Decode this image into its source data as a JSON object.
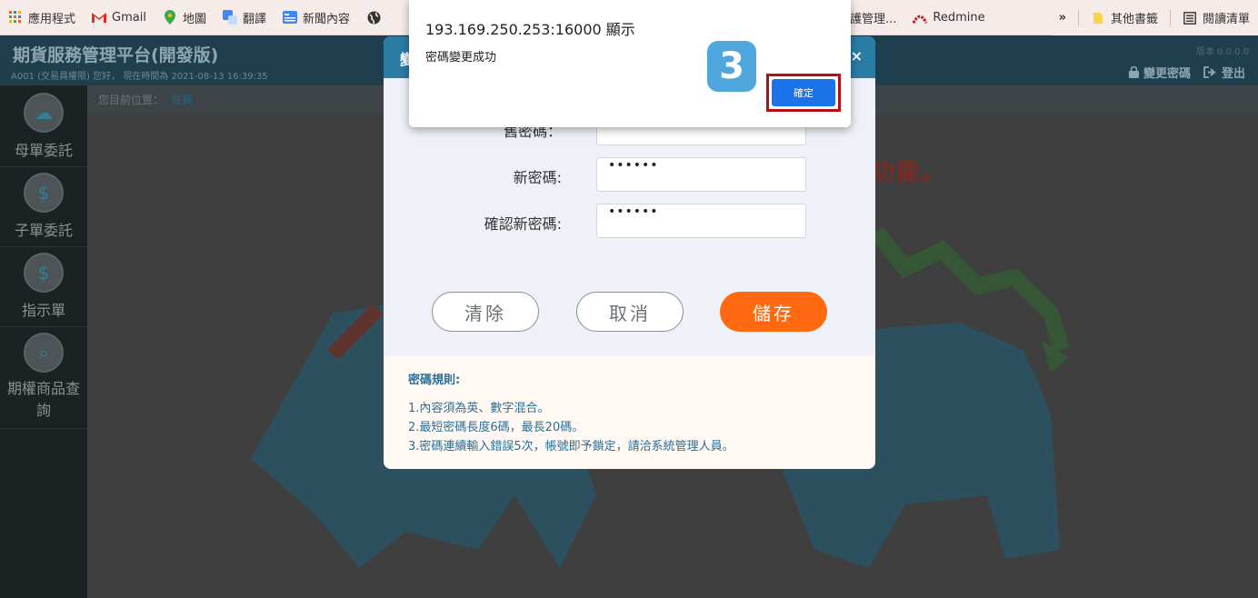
{
  "bookmarks": {
    "items": [
      {
        "label": "應用程式",
        "icon": "apps-grid-icon"
      },
      {
        "label": "Gmail",
        "icon": "gmail-icon"
      },
      {
        "label": "地圖",
        "icon": "maps-pin-icon"
      },
      {
        "label": "翻譯",
        "icon": "translate-icon"
      },
      {
        "label": "新聞內容",
        "icon": "news-icon"
      }
    ],
    "partial_label": "護管理...",
    "redmine_label": "Redmine",
    "more": "»",
    "other_bookmarks": "其他書籤",
    "reading_list": "閱讀清單"
  },
  "header": {
    "title": "期貨服務管理平台(開發版)",
    "subtitle": "A001 (交易員權限)   您好，  現在時間為   2021-08-13 16:39:35",
    "version": "版本 0.0.0.0",
    "change_password": "變更密碼",
    "logout": "登出"
  },
  "breadcrumb": {
    "prefix": "您目前位置：",
    "current": "首頁"
  },
  "sidebar": {
    "items": [
      {
        "label": "母單委託",
        "icon": "cloud-money-icon"
      },
      {
        "label": "子單委託",
        "icon": "hand-coin-icon"
      },
      {
        "label": "指示單",
        "icon": "dollar-bulb-icon"
      },
      {
        "label": "期權商品查詢",
        "icon": "search-magnifier-icon"
      }
    ]
  },
  "background": {
    "partial_text": "功能。"
  },
  "dialog": {
    "title_partial": "變",
    "close": "×",
    "fields": [
      {
        "label": "舊密碼：",
        "value": "••••••"
      },
      {
        "label": "新密碼:",
        "value": "••••••"
      },
      {
        "label": "確認新密碼:",
        "value": "••••••"
      }
    ],
    "buttons": {
      "clear": "清除",
      "cancel": "取消",
      "save": "儲存"
    },
    "rules": {
      "title": "密碼規則:",
      "lines": [
        "1.內容須為英、數字混合。",
        "2.最短密碼長度6碼，最長20碼。",
        "3.密碼連續輸入錯誤5次，帳號即予鎖定，請洽系統管理人員。"
      ]
    }
  },
  "alert": {
    "origin": "193.169.250.253:16000 顯示",
    "message": "密碼變更成功",
    "ok": "確定",
    "step_badge": "3"
  },
  "colors": {
    "accent_orange": "#ff6a10",
    "header_blue": "#2a7ca5",
    "alert_button": "#1a73e8",
    "highlight_red": "#b40f14"
  }
}
